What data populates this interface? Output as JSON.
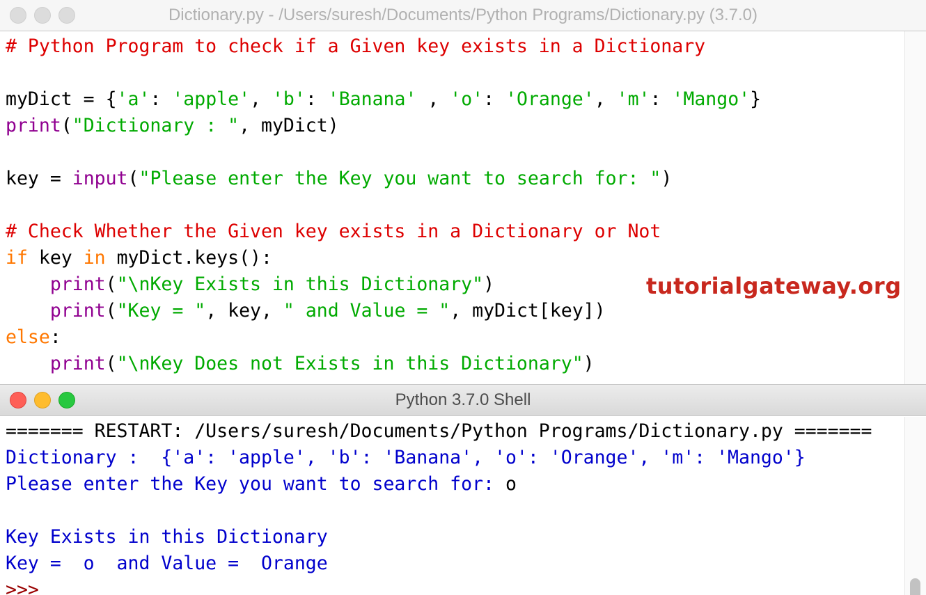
{
  "editor": {
    "title": "Dictionary.py - /Users/suresh/Documents/Python Programs/Dictionary.py (3.7.0)",
    "watermark": "tutorialgateway.org",
    "lines": [
      [
        {
          "t": "# Python Program to check if a Given key exists in a Dictionary",
          "c": "comment"
        }
      ],
      [],
      [
        {
          "t": "myDict = {",
          "c": "plain"
        },
        {
          "t": "'a'",
          "c": "string"
        },
        {
          "t": ": ",
          "c": "plain"
        },
        {
          "t": "'apple'",
          "c": "string"
        },
        {
          "t": ", ",
          "c": "plain"
        },
        {
          "t": "'b'",
          "c": "string"
        },
        {
          "t": ": ",
          "c": "plain"
        },
        {
          "t": "'Banana'",
          "c": "string"
        },
        {
          "t": " , ",
          "c": "plain"
        },
        {
          "t": "'o'",
          "c": "string"
        },
        {
          "t": ": ",
          "c": "plain"
        },
        {
          "t": "'Orange'",
          "c": "string"
        },
        {
          "t": ", ",
          "c": "plain"
        },
        {
          "t": "'m'",
          "c": "string"
        },
        {
          "t": ": ",
          "c": "plain"
        },
        {
          "t": "'Mango'",
          "c": "string"
        },
        {
          "t": "}",
          "c": "plain"
        }
      ],
      [
        {
          "t": "print",
          "c": "builtin"
        },
        {
          "t": "(",
          "c": "plain"
        },
        {
          "t": "\"Dictionary : \"",
          "c": "string"
        },
        {
          "t": ", myDict)",
          "c": "plain"
        }
      ],
      [],
      [
        {
          "t": "key = ",
          "c": "plain"
        },
        {
          "t": "input",
          "c": "builtin"
        },
        {
          "t": "(",
          "c": "plain"
        },
        {
          "t": "\"Please enter the Key you want to search for: \"",
          "c": "string"
        },
        {
          "t": ")",
          "c": "plain"
        }
      ],
      [],
      [
        {
          "t": "# Check Whether the Given key exists in a Dictionary or Not",
          "c": "comment"
        }
      ],
      [
        {
          "t": "if",
          "c": "keyword"
        },
        {
          "t": " key ",
          "c": "plain"
        },
        {
          "t": "in",
          "c": "keyword"
        },
        {
          "t": " myDict.keys():",
          "c": "plain"
        }
      ],
      [
        {
          "t": "    ",
          "c": "plain"
        },
        {
          "t": "print",
          "c": "builtin"
        },
        {
          "t": "(",
          "c": "plain"
        },
        {
          "t": "\"\\nKey Exists in this Dictionary\"",
          "c": "string"
        },
        {
          "t": ")",
          "c": "plain"
        }
      ],
      [
        {
          "t": "    ",
          "c": "plain"
        },
        {
          "t": "print",
          "c": "builtin"
        },
        {
          "t": "(",
          "c": "plain"
        },
        {
          "t": "\"Key = \"",
          "c": "string"
        },
        {
          "t": ", key, ",
          "c": "plain"
        },
        {
          "t": "\" and Value = \"",
          "c": "string"
        },
        {
          "t": ", myDict[key])",
          "c": "plain"
        }
      ],
      [
        {
          "t": "else",
          "c": "keyword"
        },
        {
          "t": ":",
          "c": "plain"
        }
      ],
      [
        {
          "t": "    ",
          "c": "plain"
        },
        {
          "t": "print",
          "c": "builtin"
        },
        {
          "t": "(",
          "c": "plain"
        },
        {
          "t": "\"\\nKey Does not Exists in this Dictionary\"",
          "c": "string"
        },
        {
          "t": ")",
          "c": "plain"
        }
      ]
    ]
  },
  "shell": {
    "title": "Python 3.7.0 Shell",
    "lines": [
      [
        {
          "t": "======= RESTART: /Users/suresh/Documents/Python Programs/Dictionary.py =======",
          "c": "plain"
        }
      ],
      [
        {
          "t": "Dictionary :  {'a': 'apple', 'b': 'Banana', 'o': 'Orange', 'm': 'Mango'}",
          "c": "out"
        }
      ],
      [
        {
          "t": "Please enter the Key you want to search for: ",
          "c": "out"
        },
        {
          "t": "o",
          "c": "plain"
        }
      ],
      [],
      [
        {
          "t": "Key Exists in this Dictionary",
          "c": "out"
        }
      ],
      [
        {
          "t": "Key =  o  and Value =  Orange",
          "c": "out"
        }
      ],
      [
        {
          "t": ">>>",
          "c": "prompt"
        }
      ]
    ]
  },
  "colors": {
    "comment": "#dd0000",
    "builtin": "#900090",
    "string": "#00aa00",
    "keyword": "#ff7700",
    "output": "#0000cc",
    "prompt": "#990000",
    "watermark": "#c8281e",
    "close_button": "#fe5f57",
    "minimize_button": "#febc2e",
    "zoom_button": "#28c840"
  }
}
